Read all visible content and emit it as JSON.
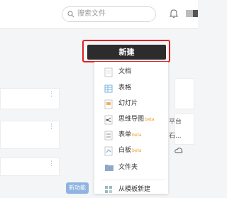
{
  "search": {
    "placeholder": "搜索文件"
  },
  "new_button": {
    "label": "新建"
  },
  "menu": {
    "items": [
      {
        "label": "文档",
        "icon": "doc-icon",
        "beta": ""
      },
      {
        "label": "表格",
        "icon": "sheet-icon",
        "beta": ""
      },
      {
        "label": "幻灯片",
        "icon": "slides-icon",
        "beta": ""
      },
      {
        "label": "思维导图",
        "icon": "mindmap-icon",
        "beta": "beta"
      },
      {
        "label": "表单",
        "icon": "form-icon",
        "beta": "beta"
      },
      {
        "label": "白板",
        "icon": "whiteboard-icon",
        "beta": "beta"
      },
      {
        "label": "文件夹",
        "icon": "folder-icon",
        "beta": ""
      },
      {
        "label": "从模板新建",
        "icon": "template-icon",
        "beta": ""
      }
    ]
  },
  "side": {
    "text1": "平台",
    "text2": "石..."
  },
  "new_feature_badge": "新功能",
  "colors": {
    "accent_red": "#e02020",
    "button_dark": "#2c2c2c",
    "beta_orange": "#f0a020"
  }
}
